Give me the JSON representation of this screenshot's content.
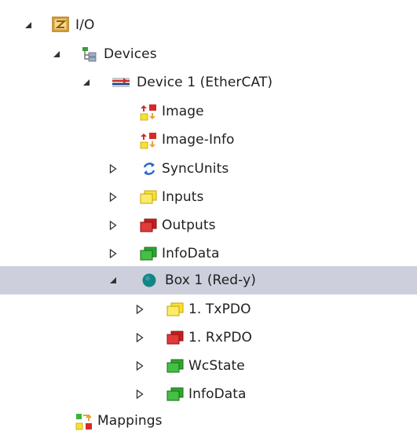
{
  "tree": {
    "root": {
      "label": "I/O",
      "icon": "io-folder-icon",
      "expanded": true
    },
    "devices": {
      "label": "Devices",
      "icon": "devices-tree-icon",
      "expanded": true
    },
    "device1": {
      "label": "Device 1 (EtherCAT)",
      "icon": "ethercat-device-icon",
      "expanded": true
    },
    "image": {
      "label": "Image",
      "icon": "process-image-icon"
    },
    "image_info": {
      "label": "Image-Info",
      "icon": "process-image-icon"
    },
    "syncunits": {
      "label": "SyncUnits",
      "icon": "sync-arrows-icon",
      "expanded": false
    },
    "inputs": {
      "label": "Inputs",
      "icon": "yellow-var-icon",
      "expanded": false
    },
    "outputs": {
      "label": "Outputs",
      "icon": "red-var-icon",
      "expanded": false
    },
    "infodata": {
      "label": "InfoData",
      "icon": "green-var-icon",
      "expanded": false
    },
    "box1": {
      "label": "Box 1 (Red-y)",
      "icon": "box-teal-circle-icon",
      "expanded": true,
      "selected": true
    },
    "txpdo": {
      "label": "1. TxPDO",
      "icon": "yellow-var-icon",
      "expanded": false
    },
    "rxpdo": {
      "label": "1. RxPDO",
      "icon": "red-var-icon",
      "expanded": false
    },
    "wcstate": {
      "label": "WcState",
      "icon": "green-var-icon",
      "expanded": false
    },
    "box_infodata": {
      "label": "InfoData",
      "icon": "green-var-icon",
      "expanded": false
    },
    "mappings": {
      "label": "Mappings",
      "icon": "mappings-icon"
    }
  },
  "colors": {
    "selection": "#cdd0dc",
    "yellow": "#f7e135",
    "red": "#d42a2a",
    "green": "#3cb43c",
    "teal": "#1a8a8a",
    "orange": "#e8a23c"
  }
}
